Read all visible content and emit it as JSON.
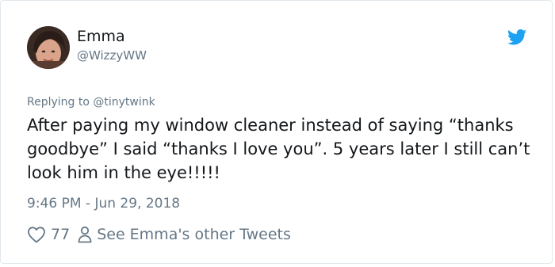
{
  "user": {
    "display_name": "Emma",
    "handle": "@WizzyWW"
  },
  "reply_to": "Replying to @tinytwink",
  "tweet": {
    "text": "After paying my window cleaner instead of saying “thanks goodbye” I said “thanks I love you”. 5 years later I still can’t look him in the eye!!!!!",
    "timestamp": "9:46 PM - Jun 29, 2018"
  },
  "actions": {
    "like_count": "77",
    "see_more_label": "See Emma's other Tweets"
  },
  "icons": {
    "logo": "twitter-bird-icon",
    "like": "heart-icon",
    "profile": "person-icon"
  },
  "colors": {
    "twitter_blue": "#1da1f2",
    "secondary_text": "#657786",
    "primary_text": "#14171a"
  }
}
